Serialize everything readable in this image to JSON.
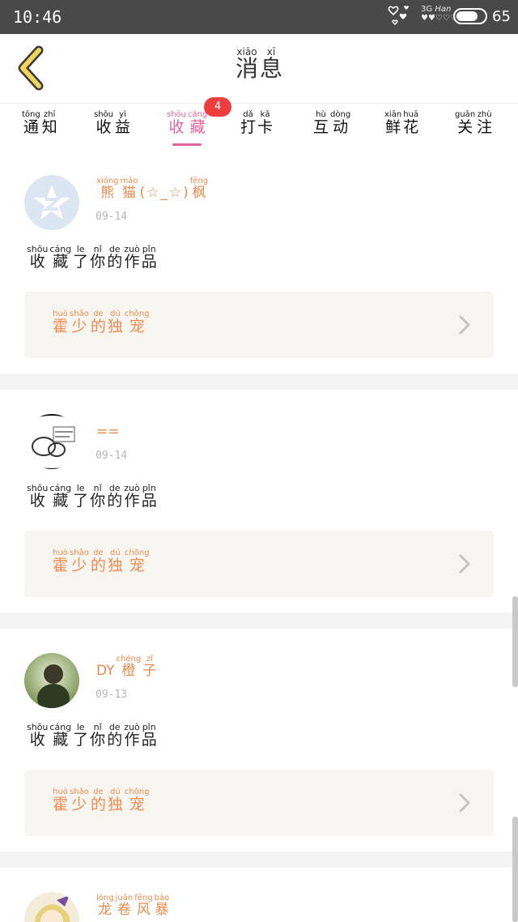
{
  "status_bar": {
    "time": "10:46",
    "network": "3G",
    "network_sub": "Han",
    "battery": "65"
  },
  "header": {
    "title": [
      {
        "py": "xiāo",
        "hz": "消"
      },
      {
        "py": "xī",
        "hz": "息"
      }
    ]
  },
  "tabs": [
    {
      "chars": [
        {
          "py": "tōng",
          "hz": "通"
        },
        {
          "py": "zhī",
          "hz": "知"
        }
      ]
    },
    {
      "chars": [
        {
          "py": "shōu",
          "hz": "收"
        },
        {
          "py": "yì",
          "hz": "益"
        }
      ]
    },
    {
      "chars": [
        {
          "py": "shōu",
          "hz": "收"
        },
        {
          "py": "cáng",
          "hz": "藏"
        }
      ],
      "active": true,
      "badge": "4"
    },
    {
      "chars": [
        {
          "py": "dǎ",
          "hz": "打"
        },
        {
          "py": "kǎ",
          "hz": "卡"
        }
      ]
    },
    {
      "chars": [
        {
          "py": "hù",
          "hz": "互"
        },
        {
          "py": "dòng",
          "hz": "动"
        }
      ]
    },
    {
      "chars": [
        {
          "py": "xiān",
          "hz": "鲜"
        },
        {
          "py": "huā",
          "hz": "花"
        }
      ]
    },
    {
      "chars": [
        {
          "py": "guān",
          "hz": "关"
        },
        {
          "py": "zhù",
          "hz": "注"
        }
      ]
    }
  ],
  "colors": {
    "accent": "#e2649a",
    "username": "#e88a4c",
    "badge": "#ee3d3d",
    "card_bg": "#f6f5ef"
  },
  "messages": [
    {
      "user": [
        {
          "py": "xióng",
          "hz": "熊"
        },
        {
          "py": "māo",
          "hz": "猫"
        },
        {
          "py": "",
          "hz": "("
        },
        {
          "py": "",
          "hz": "☆"
        },
        {
          "py": "",
          "hz": "_"
        },
        {
          "py": "",
          "hz": "☆"
        },
        {
          "py": "",
          "hz": ")"
        },
        {
          "py": "fēng",
          "hz": "枫"
        }
      ],
      "date": "09-14",
      "action": [
        {
          "py": "shōu",
          "hz": "收"
        },
        {
          "py": "cáng",
          "hz": "藏"
        },
        {
          "py": "le",
          "hz": "了"
        },
        {
          "py": "nǐ",
          "hz": "你"
        },
        {
          "py": "de",
          "hz": "的"
        },
        {
          "py": "zuò",
          "hz": "作"
        },
        {
          "py": "pǐn",
          "hz": "品"
        }
      ],
      "work": [
        {
          "py": "huò",
          "hz": "霍"
        },
        {
          "py": "shǎo",
          "hz": "少"
        },
        {
          "py": "de",
          "hz": "的"
        },
        {
          "py": "dú",
          "hz": "独"
        },
        {
          "py": "chǒng",
          "hz": "宠"
        }
      ],
      "avatar": "qzone-icon"
    },
    {
      "user": [
        {
          "py": "",
          "hz": "=="
        }
      ],
      "date": "09-14",
      "action": [
        {
          "py": "shōu",
          "hz": "收"
        },
        {
          "py": "cáng",
          "hz": "藏"
        },
        {
          "py": "le",
          "hz": "了"
        },
        {
          "py": "nǐ",
          "hz": "你"
        },
        {
          "py": "de",
          "hz": "的"
        },
        {
          "py": "zuò",
          "hz": "作"
        },
        {
          "py": "pǐn",
          "hz": "品"
        }
      ],
      "work": [
        {
          "py": "huò",
          "hz": "霍"
        },
        {
          "py": "shǎo",
          "hz": "少"
        },
        {
          "py": "de",
          "hz": "的"
        },
        {
          "py": "dú",
          "hz": "独"
        },
        {
          "py": "chǒng",
          "hz": "宠"
        }
      ],
      "avatar": "sketch-avatar"
    },
    {
      "user": [
        {
          "py": "",
          "hz": "DY"
        },
        {
          "py": "chéng",
          "hz": "橙"
        },
        {
          "py": "zǐ",
          "hz": "子"
        }
      ],
      "date": "09-13",
      "action": [
        {
          "py": "shōu",
          "hz": "收"
        },
        {
          "py": "cáng",
          "hz": "藏"
        },
        {
          "py": "le",
          "hz": "了"
        },
        {
          "py": "nǐ",
          "hz": "你"
        },
        {
          "py": "de",
          "hz": "的"
        },
        {
          "py": "zuò",
          "hz": "作"
        },
        {
          "py": "pǐn",
          "hz": "品"
        }
      ],
      "work": [
        {
          "py": "huò",
          "hz": "霍"
        },
        {
          "py": "shǎo",
          "hz": "少"
        },
        {
          "py": "de",
          "hz": "的"
        },
        {
          "py": "dú",
          "hz": "独"
        },
        {
          "py": "chǒng",
          "hz": "宠"
        }
      ],
      "avatar": "photo-avatar"
    },
    {
      "user": [
        {
          "py": "lóng",
          "hz": "龙"
        },
        {
          "py": "juǎn",
          "hz": "卷"
        },
        {
          "py": "fēng",
          "hz": "风"
        },
        {
          "py": "bào",
          "hz": "暴"
        }
      ],
      "avatar": "anime-avatar"
    }
  ]
}
